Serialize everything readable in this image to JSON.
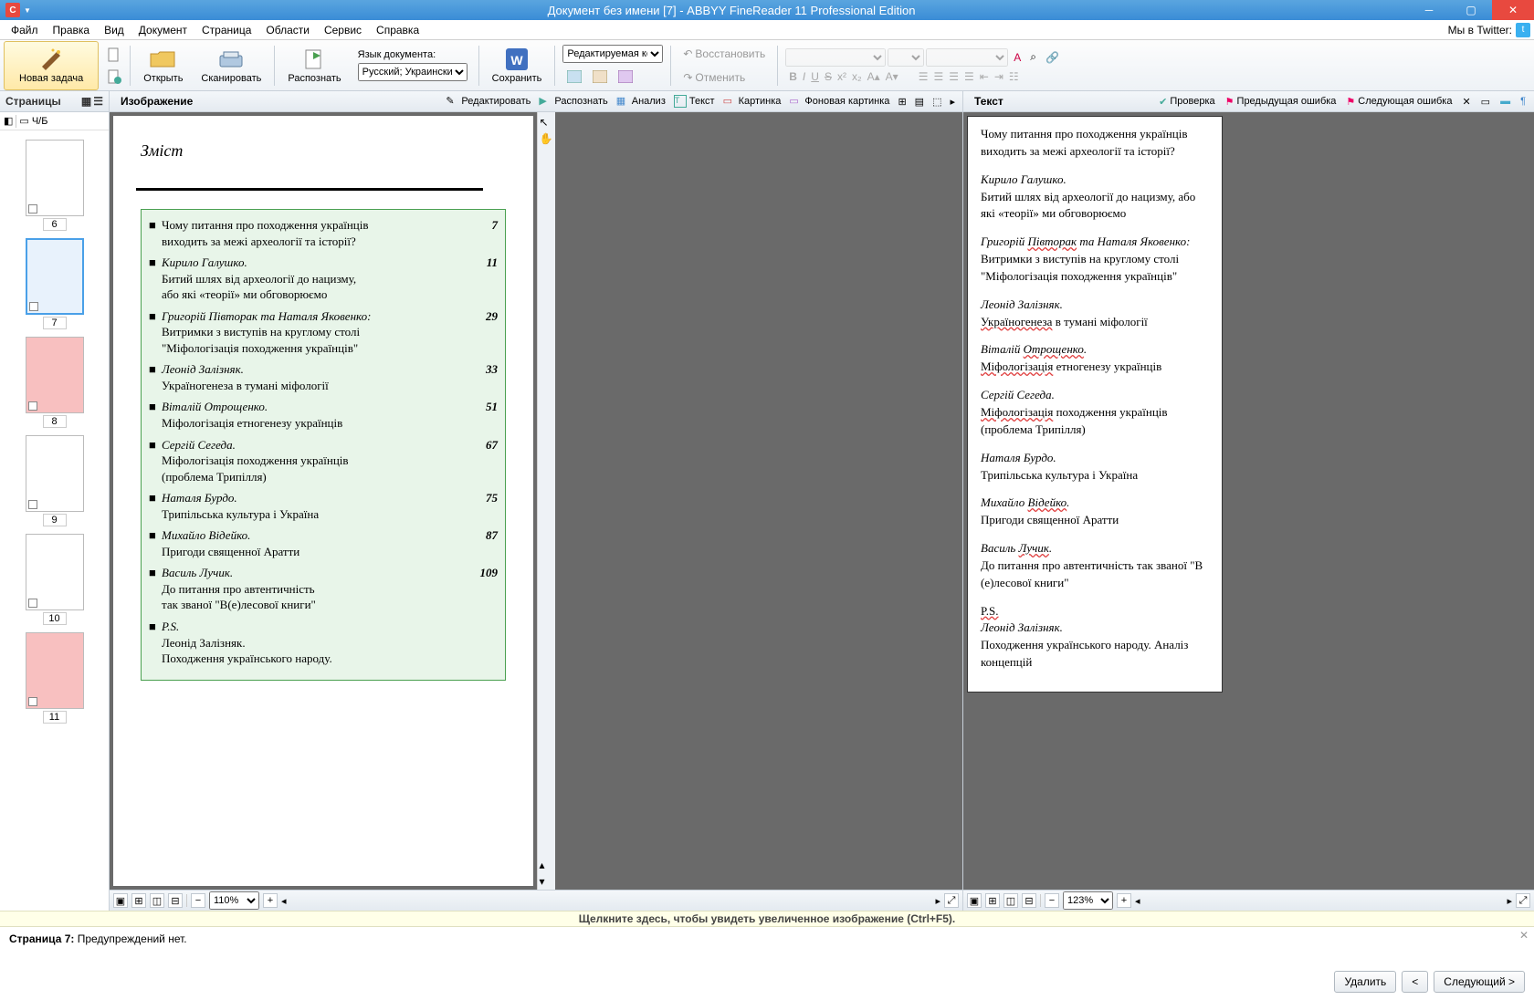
{
  "app": {
    "title": "Документ без имени [7] - ABBYY FineReader 11 Professional Edition",
    "twitter_label": "Мы в Twitter:"
  },
  "menu": {
    "file": "Файл",
    "edit": "Правка",
    "view": "Вид",
    "document": "Документ",
    "page": "Страница",
    "areas": "Области",
    "service": "Сервис",
    "help": "Справка"
  },
  "toolbar": {
    "new_task": "Новая задача",
    "open": "Открыть",
    "scan": "Сканировать",
    "recognize": "Распознать",
    "save": "Сохранить",
    "lang_label": "Язык документа:",
    "lang_value": "Русский; Украински",
    "layout_value": "Редактируемая копи",
    "restore": "Восстановить",
    "cancel": "Отменить"
  },
  "pages": {
    "title": "Страницы",
    "bw_label": "Ч/Б",
    "thumbs": [
      {
        "num": "6",
        "sel": false,
        "red": false
      },
      {
        "num": "7",
        "sel": true,
        "red": false
      },
      {
        "num": "8",
        "sel": false,
        "red": true
      },
      {
        "num": "9",
        "sel": false,
        "red": false
      },
      {
        "num": "10",
        "sel": false,
        "red": false
      },
      {
        "num": "11",
        "sel": false,
        "red": true
      }
    ]
  },
  "image": {
    "title": "Изображение",
    "tools": {
      "edit": "Редактировать",
      "recognize": "Распознать",
      "analyze": "Анализ",
      "text": "Текст",
      "picture": "Картинка",
      "bgpic": "Фоновая картинка"
    },
    "zoom": "110%",
    "toc_title": "Зміст",
    "toc": [
      {
        "author": "",
        "line1": "Чому питання про походження українців",
        "line2": "виходить за межі археології та історії?",
        "pg": "7"
      },
      {
        "author": "Кирило Галушко.",
        "line1": "Битий шлях від археології до нацизму,",
        "line2": "або які «теорії» ми обговорюємо",
        "pg": "11"
      },
      {
        "author": "Григорій Півторак та Наталя Яковенко:",
        "line1": "Витримки з виступів на круглому столі",
        "line2": "\"Міфологізація походження українців\"",
        "pg": "29"
      },
      {
        "author": "Леонід Залізняк.",
        "line1": "Україногенеза в тумані міфології",
        "line2": "",
        "pg": "33"
      },
      {
        "author": "Віталій Отрощенко.",
        "line1": "Міфологізація етногенезу українців",
        "line2": "",
        "pg": "51"
      },
      {
        "author": "Сергій Сегеда.",
        "line1": "Міфологізація походження українців",
        "line2": "(проблема Трипілля)",
        "pg": "67"
      },
      {
        "author": "Наталя Бурдо.",
        "line1": "Трипільська культура і Україна",
        "line2": "",
        "pg": "75"
      },
      {
        "author": "Михайло Відейко.",
        "line1": "Пригоди священної Аратти",
        "line2": "",
        "pg": "87"
      },
      {
        "author": "Василь Лучик.",
        "line1": "До питання про автентичність",
        "line2": "так званої \"В(е)лесової книги\"",
        "pg": "109"
      },
      {
        "author": "P.S.",
        "line1": "Леонід Залізняк.",
        "line2": "Походження українського народу.",
        "pg": ""
      }
    ]
  },
  "text": {
    "title": "Текст",
    "tools": {
      "check": "Проверка",
      "prev_err": "Предыдущая ошибка",
      "next_err": "Следующая ошибка"
    },
    "zoom": "123%",
    "content": {
      "p1": "Чому питання про походження українців виходить за межі археології та історії?",
      "a2": "Кирило Галушко.",
      "p2": "Битий шлях від археології до нацизму, або які «теорії» ми обговорюємо",
      "a3a": "Григорій ",
      "a3e1": "Півторак",
      "a3b": " та ",
      "a3c": "Наталя Яковенко:",
      "p3": "Витримки з виступів на круглому столі \"Міфологізація походження українців\"",
      "a4": "Леонід Залізняк.",
      "p4a": "Україногенеза",
      "p4b": " в тумані міфології",
      "a5a": "Віталій ",
      "a5e": "Отрощенко",
      "a5b": ".",
      "p5a": "Міфологізація",
      "p5b": " етногенезу українців",
      "a6": "Сергій Сегеда.",
      "p6a": "Міфологізація",
      "p6b": " походження українців (проблема Трипілля)",
      "a7": "Наталя Бурдо.",
      "p7": "Трипільська культура і Україна",
      "a8a": "Михайло ",
      "a8e": "Відейко",
      "a8b": ".",
      "p8": "Пригоди священної Аратти",
      "a9a": "Василь ",
      "a9e": "Лучик",
      "a9b": ".",
      "p9": "До питання про автентичність так званої \"В (е)лесової книги\"",
      "a10": "P.S.",
      "a11": "Леонід Залізняк.",
      "p11": "Походження українського народу. Аналіз концепцій"
    }
  },
  "hint": "Щелкните здесь, чтобы увидеть увеличенное изображение (Ctrl+F5).",
  "status": {
    "page_label": "Страница 7:",
    "msg": "Предупреждений нет.",
    "delete": "Удалить",
    "prev": "<",
    "next": "Следующий >"
  }
}
